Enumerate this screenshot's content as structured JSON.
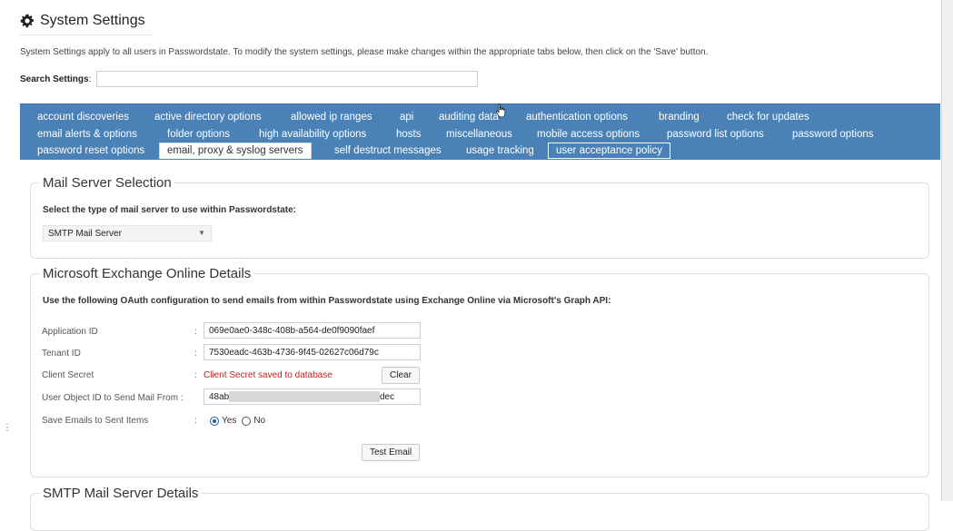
{
  "page": {
    "title": "System Settings",
    "description": "System Settings apply to all users in Passwordstate. To modify the system settings, please make changes within the appropriate tabs below, then click on the 'Save' button.",
    "search": {
      "label": "Search Settings",
      "colon": ":",
      "value": "",
      "placeholder": ""
    }
  },
  "tabs": [
    {
      "label": "account discoveries"
    },
    {
      "label": "active directory options"
    },
    {
      "label": "allowed ip ranges"
    },
    {
      "label": "api"
    },
    {
      "label": "auditing data"
    },
    {
      "label": "authentication options"
    },
    {
      "label": "branding"
    },
    {
      "label": "check for updates"
    },
    {
      "label": "email alerts & options"
    },
    {
      "label": "folder options"
    },
    {
      "label": "high availability options"
    },
    {
      "label": "hosts"
    },
    {
      "label": "miscellaneous"
    },
    {
      "label": "mobile access options"
    },
    {
      "label": "password list options"
    },
    {
      "label": "password options"
    },
    {
      "label": "password reset options"
    },
    {
      "label": "email, proxy & syslog servers",
      "active": true
    },
    {
      "label": "self destruct messages"
    },
    {
      "label": "usage tracking"
    },
    {
      "label": "user acceptance policy"
    }
  ],
  "mail_server": {
    "legend": "Mail Server Selection",
    "note": "Select the type of mail server to use within Passwordstate:",
    "selected": "SMTP Mail Server"
  },
  "exchange": {
    "legend": "Microsoft Exchange Online Details",
    "note": "Use the following OAuth configuration to send emails from within Passwordstate using Exchange Online via Microsoft's Graph API:",
    "colon": ":",
    "app_id_label": "Application ID",
    "app_id_value": "069e0ae0-348c-408b-a564-de0f9090faef",
    "tenant_label": "Tenant ID",
    "tenant_value": "7530eadc-463b-4736-9f45-02627c06d79c",
    "secret_label": "Client Secret",
    "secret_status": "Client Secret saved to database",
    "clear_label": "Clear",
    "user_object_label": "User Object ID to Send Mail From :",
    "user_object_start": "48abb",
    "user_object_end": "dec",
    "save_sent_label": "Save Emails to Sent Items",
    "yes_label": "Yes",
    "no_label": "No",
    "test_label": "Test Email"
  },
  "smtp": {
    "legend": "SMTP Mail Server Details"
  },
  "colors": {
    "tab_bar": "#4a81b6",
    "error_text": "#c81c1c",
    "radio_selected": "#1e5aa8"
  }
}
